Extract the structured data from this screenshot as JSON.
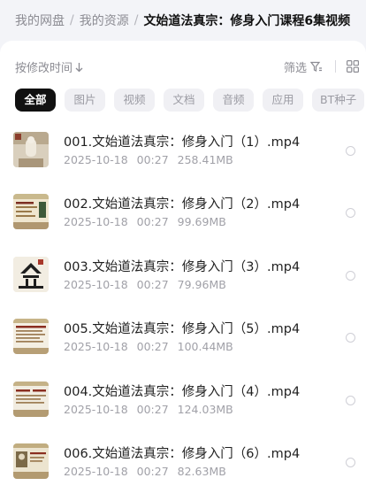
{
  "breadcrumb": {
    "root": "我的网盘",
    "parent": "我的资源",
    "current": "文始道法真宗：修身入门课程6集视频"
  },
  "toolbar": {
    "sort_label": "按修改时间",
    "sort_icon": "arrow-down",
    "filter_label": "筛选",
    "filter_icon": "filter-icon",
    "view_icon": "grid-view-icon"
  },
  "filter_chips": [
    "全部",
    "图片",
    "视频",
    "文档",
    "音频",
    "应用",
    "BT种子"
  ],
  "active_chip": "全部",
  "files": [
    {
      "name": "001.文始道法真宗：修身入门（1）.mp4",
      "date": "2025-10-18",
      "time": "00:27",
      "size": "258.41MB"
    },
    {
      "name": "002.文始道法真宗：修身入门（2）.mp4",
      "date": "2025-10-18",
      "time": "00:27",
      "size": "99.69MB"
    },
    {
      "name": "003.文始道法真宗：修身入门（3）.mp4",
      "date": "2025-10-18",
      "time": "00:27",
      "size": "79.96MB"
    },
    {
      "name": "005.文始道法真宗：修身入门（5）.mp4",
      "date": "2025-10-18",
      "time": "00:27",
      "size": "100.44MB"
    },
    {
      "name": "004.文始道法真宗：修身入门（4）.mp4",
      "date": "2025-10-18",
      "time": "00:27",
      "size": "124.03MB"
    },
    {
      "name": "006.文始道法真宗：修身入门（6）.mp4",
      "date": "2025-10-18",
      "time": "00:27",
      "size": "82.63MB"
    }
  ]
}
